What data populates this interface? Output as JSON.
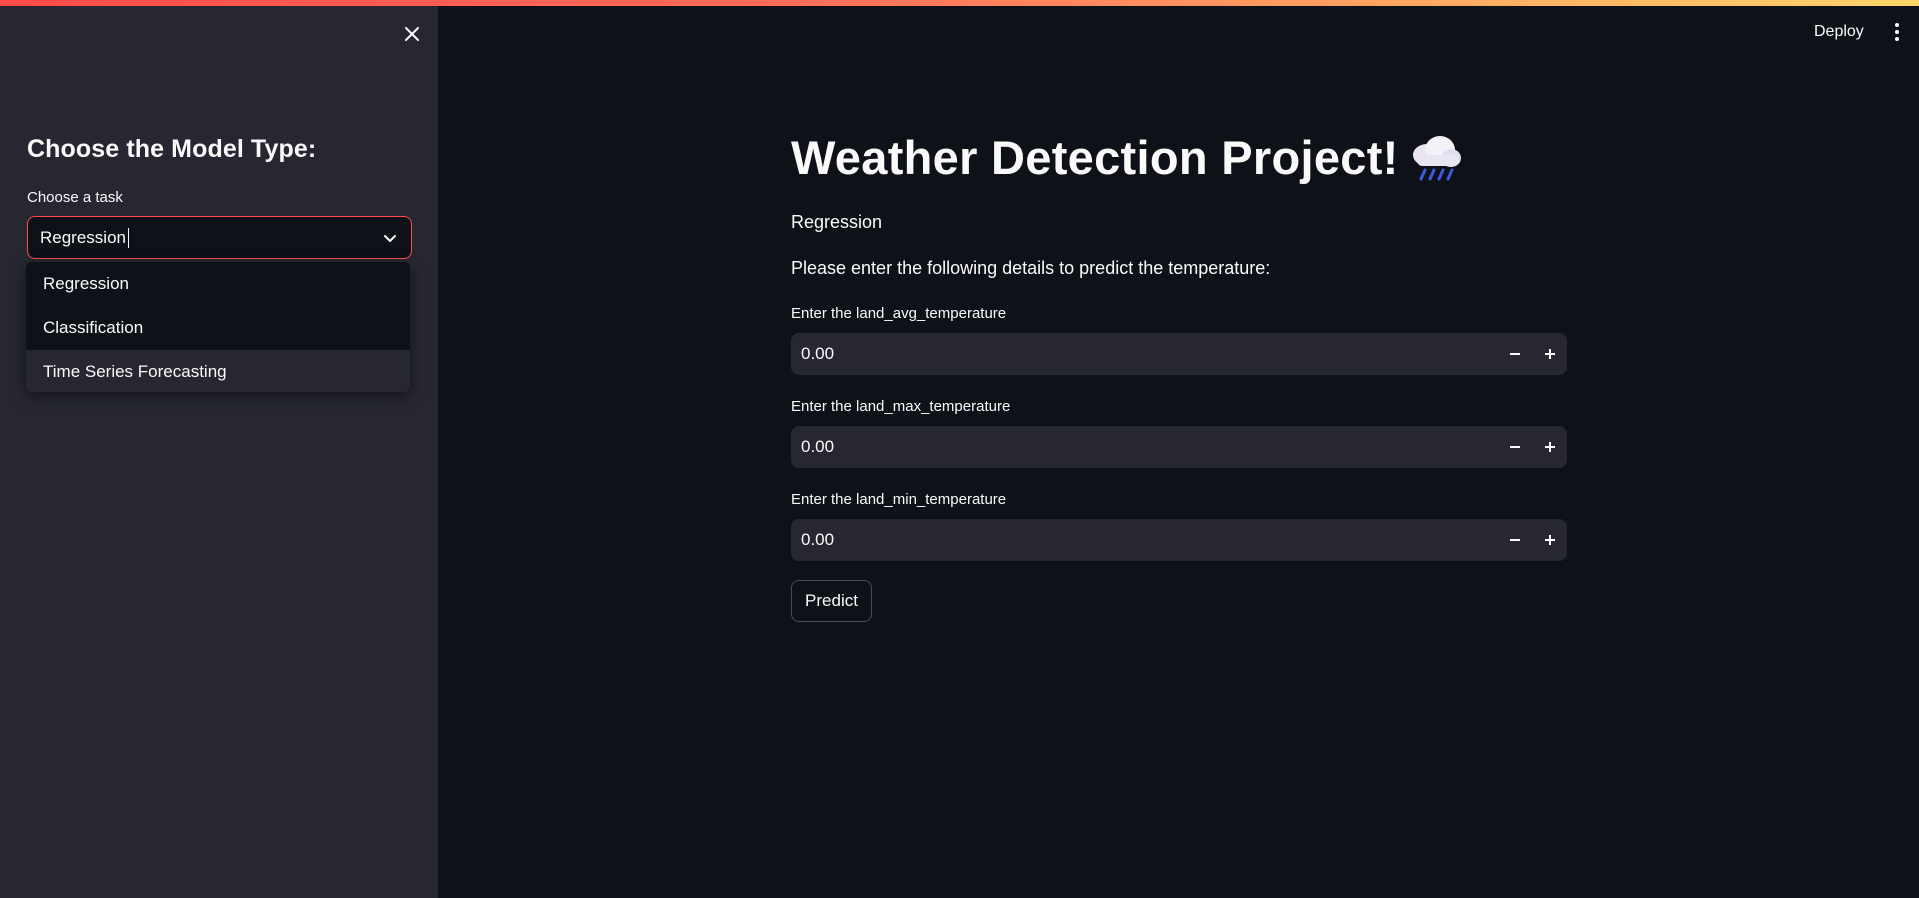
{
  "header": {
    "deploy_label": "Deploy",
    "menu_icon": "vertical-dots-icon"
  },
  "sidebar": {
    "close_icon": "close-icon",
    "heading": "Choose the Model Type:",
    "select": {
      "label": "Choose a task",
      "value": "Regression",
      "chevron_icon": "chevron-down-icon",
      "accent_color": "#ff4b4b"
    },
    "options": [
      "Regression",
      "Classification",
      "Time Series Forecasting"
    ]
  },
  "main": {
    "title": "Weather Detection Project!",
    "title_icon": "cloud-with-rain-icon",
    "mode": "Regression",
    "instruction": "Please enter the following details to predict the temperature:",
    "fields": [
      {
        "label": "Enter the land_avg_temperature",
        "value": "0.00"
      },
      {
        "label": "Enter the land_max_temperature",
        "value": "0.00"
      },
      {
        "label": "Enter the land_min_temperature",
        "value": "0.00"
      }
    ],
    "predict_label": "Predict"
  }
}
